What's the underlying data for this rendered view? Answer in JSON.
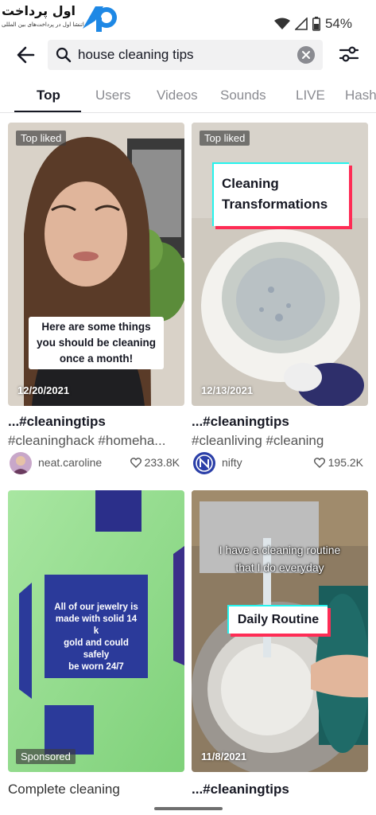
{
  "watermark": {
    "title": "اول پرداخت",
    "subtitle": "اتنشا اول در پرداخت‌های بین المللی"
  },
  "status": {
    "battery": "54%"
  },
  "search": {
    "query": "house cleaning tips"
  },
  "tabs": [
    {
      "label": "Top",
      "active": true
    },
    {
      "label": "Users",
      "active": false
    },
    {
      "label": "Videos",
      "active": false
    },
    {
      "label": "Sounds",
      "active": false
    },
    {
      "label": "LIVE",
      "active": false
    },
    {
      "label": "Hashtags",
      "active": false
    }
  ],
  "results": [
    {
      "badge": "Top liked",
      "overlay": "Here are some things you should be cleaning once a month!",
      "overlay_lines": [
        "Here are some things",
        "you should be cleaning",
        "once a month!"
      ],
      "date": "12/20/2021",
      "caption": "...#cleaningtips",
      "hashtags": "#cleaninghack #homeha...",
      "author": "neat.caroline",
      "likes": "233.8K"
    },
    {
      "badge": "Top liked",
      "overlay_lines": [
        "Cleaning",
        "Transformations"
      ],
      "date": "12/13/2021",
      "caption": "...#cleaningtips",
      "hashtags": "#cleanliving #cleaning",
      "author": "nifty",
      "likes": "195.2K"
    },
    {
      "badge": "Sponsored",
      "overlay_lines": [
        "All of our jewelry is",
        "made with solid 14 k",
        "gold and could safely",
        "be worn 24/7"
      ],
      "caption": "Complete cleaning"
    },
    {
      "overlay_top_lines": [
        "I have a cleaning routine",
        "that I do everyday"
      ],
      "overlay_lines": [
        "Daily Routine"
      ],
      "date": "11/8/2021",
      "caption": "...#cleaningtips"
    }
  ],
  "colors": {
    "accent_cyan": "#25f4ee",
    "accent_red": "#fe2c55",
    "text_primary": "#161823",
    "text_secondary": "#8a8b91",
    "watermark_blue": "#1e88e5"
  }
}
